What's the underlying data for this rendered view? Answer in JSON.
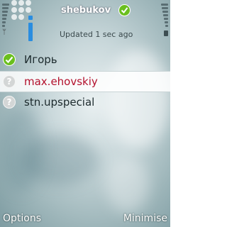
{
  "header": {
    "title": "shebukov",
    "status_icon": "online-check-icon",
    "subtitle": "Updated 1 sec ago"
  },
  "contacts": [
    {
      "name": "Игорь",
      "status": "online",
      "icon": "check-icon"
    },
    {
      "name": "max.ehovskiy",
      "status": "offline",
      "icon": "question-icon",
      "selected": true
    },
    {
      "name": "stn.upspecial",
      "status": "offline",
      "icon": "question-icon"
    }
  ],
  "softkeys": {
    "left": "Options",
    "right": "Minimise"
  },
  "colors": {
    "selected_text": "#b3102c",
    "online": "#6abf1e",
    "offline": "#d3d6d6",
    "accent_bar": "#2a8de0"
  }
}
